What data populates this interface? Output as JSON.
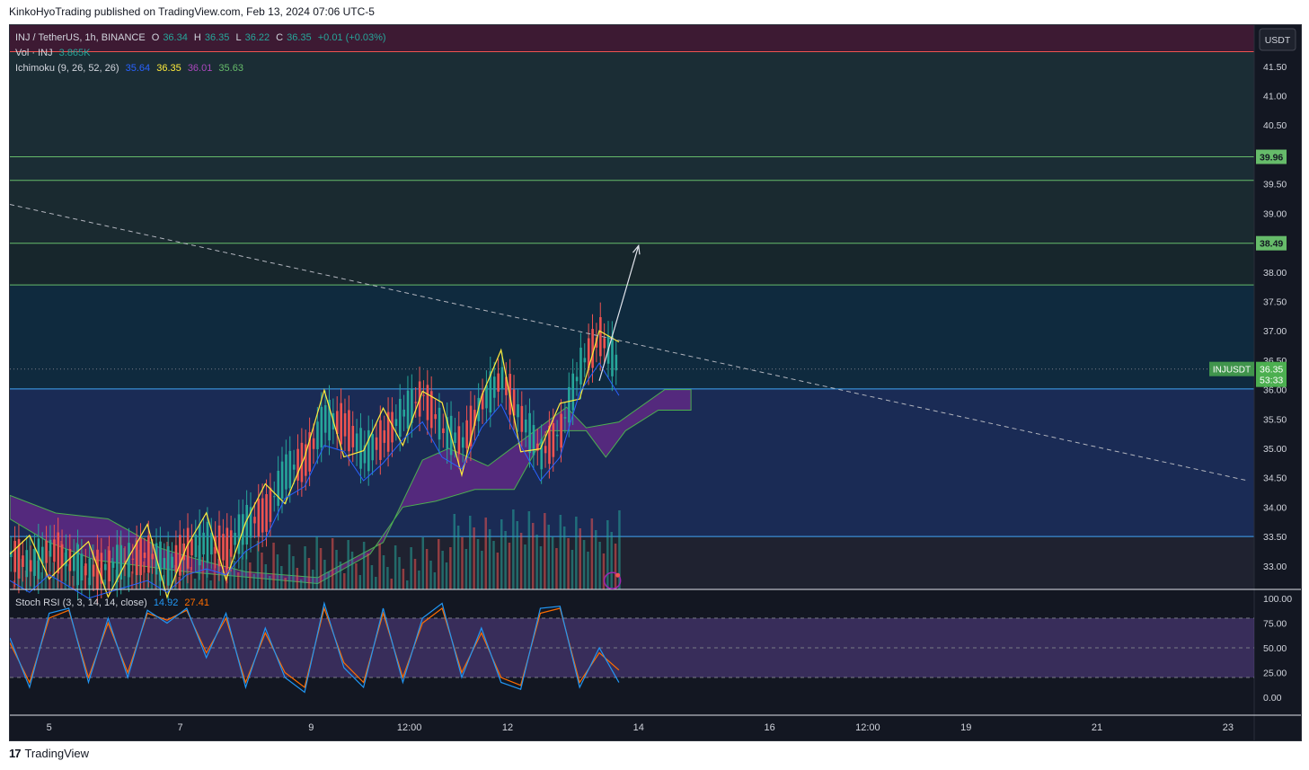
{
  "header": {
    "publisher": "KinkoHyoTrading published on TradingView.com, Feb 13, 2024 07:06 UTC-5"
  },
  "footer": {
    "brand": "TradingView",
    "logo": "17"
  },
  "colors": {
    "background": "#131722",
    "up": "#26a69a",
    "down": "#ef5350",
    "tenkan": "#2962ff",
    "kijun": "#ffeb3b",
    "ichimoku_green": "#4caf50",
    "ichimoku_purple": "#9c27b0",
    "stoch_k": "#2196f3",
    "stoch_d": "#ff6d00",
    "level_green": "#66bb6a",
    "level_blue": "#42a5f5",
    "level_red": "#ef5350"
  },
  "legend": {
    "symbol": "INJ / TetherUS, 1h, BINANCE",
    "o_label": "O",
    "o_value": "36.34",
    "h_label": "H",
    "h_value": "36.35",
    "l_label": "L",
    "l_value": "36.22",
    "c_label": "C",
    "c_value": "36.35",
    "change": "+0.01 (+0.03%)",
    "vol_label": "Vol · INJ",
    "vol_value": "3.865K",
    "ichimoku_label": "Ichimoku (9, 26, 52, 26)",
    "ich1": "35.64",
    "ich2": "36.35",
    "ich3": "36.01",
    "ich4": "35.63",
    "stoch_label": "Stoch RSI (3, 3, 14, 14, close)",
    "stoch_k": "14.92",
    "stoch_d": "27.41"
  },
  "price_axis": {
    "currency": "USDT",
    "ticks": [
      "41.50",
      "41.00",
      "40.50",
      "39.50",
      "39.00",
      "38.00",
      "37.50",
      "37.00",
      "36.50",
      "36.00",
      "35.50",
      "35.00",
      "34.50",
      "34.00",
      "33.50",
      "33.00"
    ],
    "tick_values": [
      41.5,
      41.0,
      40.5,
      39.5,
      39.0,
      38.0,
      37.5,
      37.0,
      36.5,
      36.0,
      35.5,
      35.0,
      34.5,
      34.0,
      33.5,
      33.0
    ],
    "labels": [
      {
        "text": "39.96",
        "value": 39.96,
        "color": "#66bb6a"
      },
      {
        "text": "38.49",
        "value": 38.49,
        "color": "#66bb6a"
      }
    ],
    "current_symbol": "INJUSDT",
    "current_price": "36.35",
    "countdown": "53:33"
  },
  "stoch_axis": {
    "ticks": [
      "100.00",
      "75.00",
      "50.00",
      "25.00",
      "0.00"
    ],
    "tick_values": [
      100,
      75,
      50,
      25,
      0
    ]
  },
  "time_axis": {
    "labels": [
      "5",
      "7",
      "9",
      "12:00",
      "12",
      "14",
      "16",
      "12:00",
      "19",
      "21",
      "23"
    ],
    "label_days": [
      4.5,
      6.5,
      8.5,
      10,
      11.5,
      13.5,
      15.5,
      17,
      18.5,
      20.5,
      22.5
    ]
  },
  "chart_data": {
    "type": "candlestick",
    "symbol": "INJ / TetherUS",
    "interval": "1h",
    "x_range_days": [
      3.9,
      22.9
    ],
    "ylim": [
      32.6,
      42.2
    ],
    "levels": [
      {
        "price": 41.75,
        "color": "#ef5350"
      },
      {
        "price": 39.96,
        "color": "#66bb6a"
      },
      {
        "price": 39.56,
        "color": "#66bb6a"
      },
      {
        "price": 38.49,
        "color": "#66bb6a"
      },
      {
        "price": 37.78,
        "color": "#66bb6a"
      },
      {
        "price": 36.01,
        "color": "#42a5f5"
      },
      {
        "price": 33.5,
        "color": "#42a5f5"
      }
    ],
    "close_series": {
      "days": [
        3.9,
        4.2,
        4.5,
        4.8,
        5.1,
        5.4,
        5.7,
        6.0,
        6.3,
        6.6,
        6.9,
        7.2,
        7.5,
        7.8,
        8.1,
        8.4,
        8.7,
        9.0,
        9.3,
        9.6,
        9.9,
        10.2,
        10.5,
        10.8,
        11.1,
        11.4,
        11.7,
        12.0,
        12.3,
        12.6,
        12.9,
        13.2
      ],
      "close": [
        33.2,
        33.0,
        33.3,
        33.1,
        32.9,
        33.0,
        33.1,
        33.2,
        33.0,
        33.3,
        33.4,
        33.3,
        33.7,
        33.9,
        34.6,
        34.8,
        35.5,
        35.4,
        34.9,
        35.2,
        35.6,
        35.9,
        35.3,
        35.1,
        35.8,
        36.2,
        35.5,
        34.9,
        35.3,
        36.4,
        36.9,
        36.35
      ]
    },
    "ichimoku": {
      "tenkan_end": 35.64,
      "kijun_end": 36.35,
      "span_a_end": 36.01,
      "span_b_end": 35.63
    },
    "trendline": {
      "from_day": 3.9,
      "from_price": 39.15,
      "to_day": 22.8,
      "to_price": 34.45
    },
    "projection_arrow": {
      "from_day": 12.9,
      "from_price": 36.15,
      "to_day": 13.5,
      "to_price": 38.45
    },
    "volume_last": "3.865K",
    "stoch_rsi": {
      "days": [
        3.9,
        4.2,
        4.5,
        4.8,
        5.1,
        5.4,
        5.7,
        6.0,
        6.3,
        6.6,
        6.9,
        7.2,
        7.5,
        7.8,
        8.1,
        8.4,
        8.7,
        9.0,
        9.3,
        9.6,
        9.9,
        10.2,
        10.5,
        10.8,
        11.1,
        11.4,
        11.7,
        12.0,
        12.3,
        12.6,
        12.9,
        13.2
      ],
      "k": [
        60,
        10,
        85,
        90,
        15,
        80,
        20,
        88,
        75,
        90,
        40,
        85,
        10,
        70,
        20,
        5,
        95,
        30,
        10,
        90,
        15,
        80,
        95,
        20,
        70,
        15,
        8,
        90,
        92,
        10,
        50,
        14.92
      ],
      "d": [
        55,
        15,
        80,
        88,
        20,
        75,
        25,
        85,
        78,
        88,
        45,
        80,
        15,
        65,
        25,
        10,
        90,
        35,
        15,
        85,
        20,
        75,
        90,
        25,
        65,
        20,
        12,
        85,
        90,
        15,
        45,
        27.41
      ],
      "overbought": 80,
      "oversold": 20
    }
  }
}
